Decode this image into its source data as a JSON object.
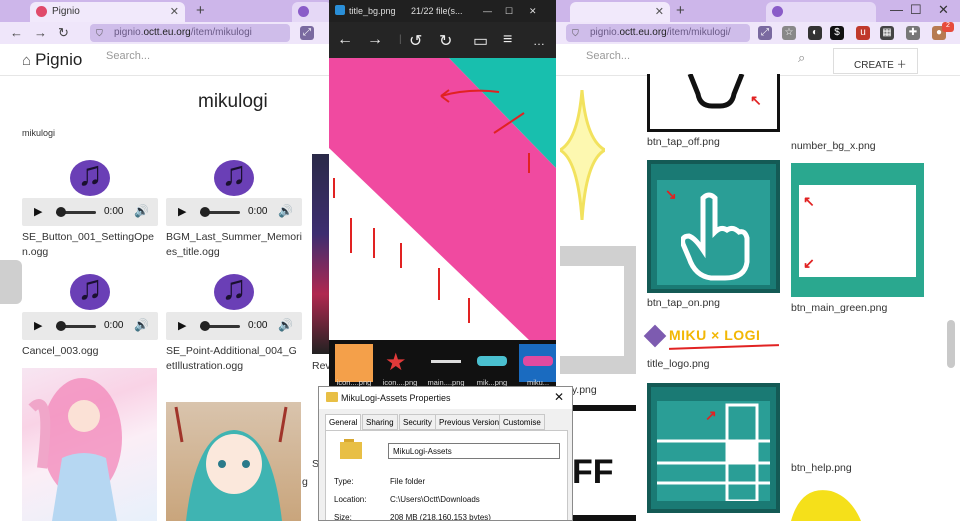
{
  "left_browser": {
    "tab_title": "Pignio",
    "url_domain": "pignio.",
    "url_highlight": "octt.eu.org",
    "url_path": "/item/mikulogi",
    "site_name": "Pignio",
    "search_placeholder": "Search...",
    "page_title": "mikulogi",
    "breadcrumb": "mikulogi",
    "audio_items": [
      {
        "filename": "SE_Button_001_SettingOpen.ogg",
        "time": "0:00"
      },
      {
        "filename": "BGM_Last_Summer_Memories_title.ogg",
        "time": "0:00"
      },
      {
        "filename": "Cancel_003.ogg",
        "time": "0:00"
      },
      {
        "filename": "SE_Point-Additional_004_GetIllustration.ogg",
        "time": "0:00"
      }
    ],
    "partial_labels": [
      "Rev",
      "S",
      "g"
    ]
  },
  "viewer": {
    "title": "title_bg.png",
    "counter": "21/22 file(s...",
    "thumbnails": [
      "icon....png",
      "icon....png",
      "main....png",
      "mik...png",
      "miku..."
    ]
  },
  "properties": {
    "title": "MikuLogi-Assets Properties",
    "tabs": [
      "General",
      "Sharing",
      "Security",
      "Previous Versions",
      "Customise"
    ],
    "name": "MikuLogi-Assets",
    "type_label": "Type:",
    "type_value": "File folder",
    "location_label": "Location:",
    "location_value": "C:\\Users\\Octt\\Downloads",
    "size_label": "Size:",
    "size_value": "208 MB (218,160,153 bytes)"
  },
  "right_browser": {
    "url_domain": "pignio.",
    "url_highlight": "octt.eu.org",
    "url_path": "/item/mikulogi/",
    "search_placeholder": "Search...",
    "create_label": "CREATE",
    "badge_count": "2",
    "tiles": [
      "btn_tap_off.png",
      "number_bg_x.png",
      "btn_tap_on.png",
      "btn_main_green.png",
      "title_logo.png",
      "btn_help.png",
      "..y.png"
    ],
    "logo_text": "MIKU × LOGI",
    "ff_text": "FF"
  }
}
